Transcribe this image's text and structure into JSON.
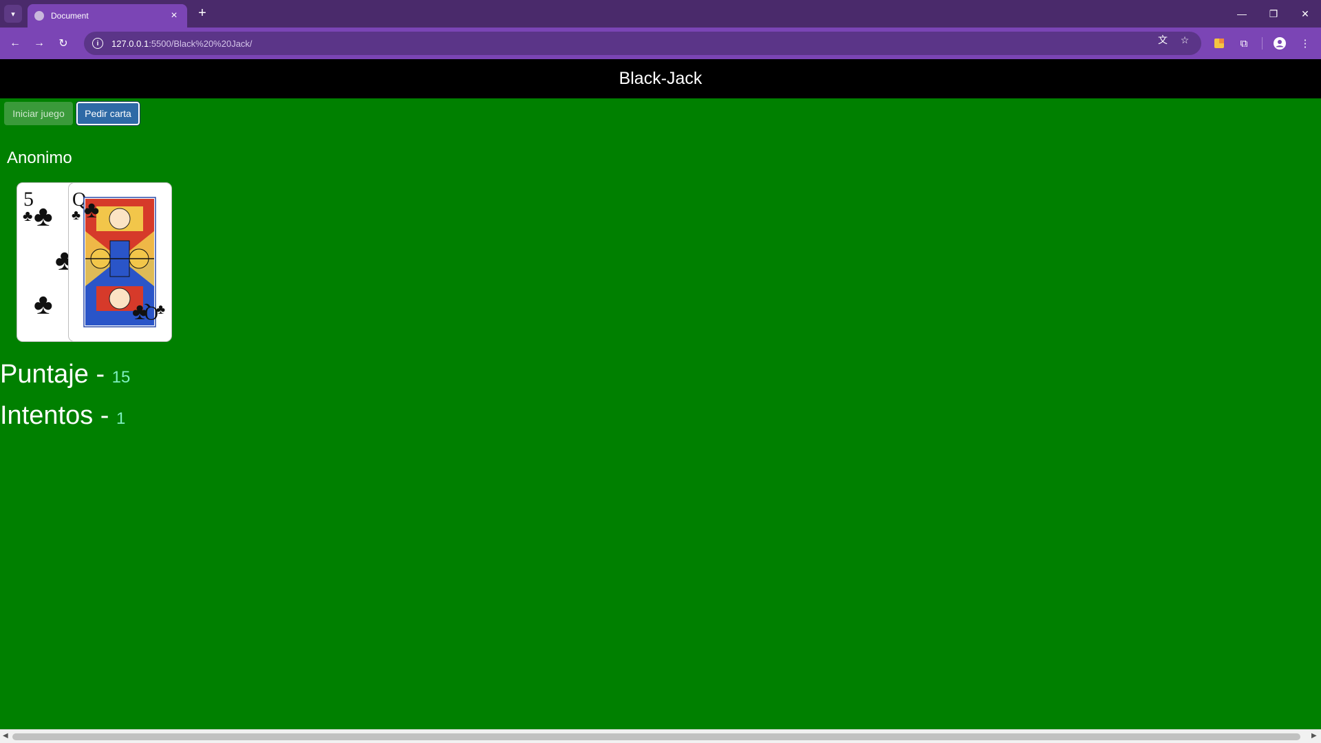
{
  "browser": {
    "tab_title": "Document",
    "url_host": "127.0.0.1",
    "url_path": ":5500/Black%20%20Jack/",
    "icons": {
      "tab_list": "chevron-down-icon",
      "favicon": "globe-icon",
      "tab_close": "close-icon",
      "new_tab": "plus-icon",
      "back": "arrow-left-icon",
      "forward": "arrow-right-icon",
      "reload": "reload-icon",
      "site_info": "info-icon",
      "translate": "translate-icon",
      "bookmark": "star-icon",
      "extension_color": "extension-icon",
      "extensions": "puzzle-icon",
      "profile": "profile-icon",
      "menu": "kebab-menu-icon",
      "minimize": "minimize-icon",
      "restore": "restore-icon",
      "close_window": "close-icon"
    },
    "colors": {
      "tabbar": "#4a2a6b",
      "toolbar": "#7b45b5"
    }
  },
  "page": {
    "title": "Black-Jack",
    "buttons": {
      "start": "Iniciar juego",
      "draw": "Pedir carta"
    },
    "player_name": "Anonimo",
    "cards": [
      {
        "rank": "5",
        "suit": "♣"
      },
      {
        "rank": "Q",
        "suit": "♣"
      }
    ],
    "score_label": "Puntaje - ",
    "score_value": "15",
    "attempts_label": "Intentos - ",
    "attempts_value": "1",
    "colors": {
      "table": "#008000",
      "header": "#000000",
      "value": "#7ff0c0"
    }
  }
}
